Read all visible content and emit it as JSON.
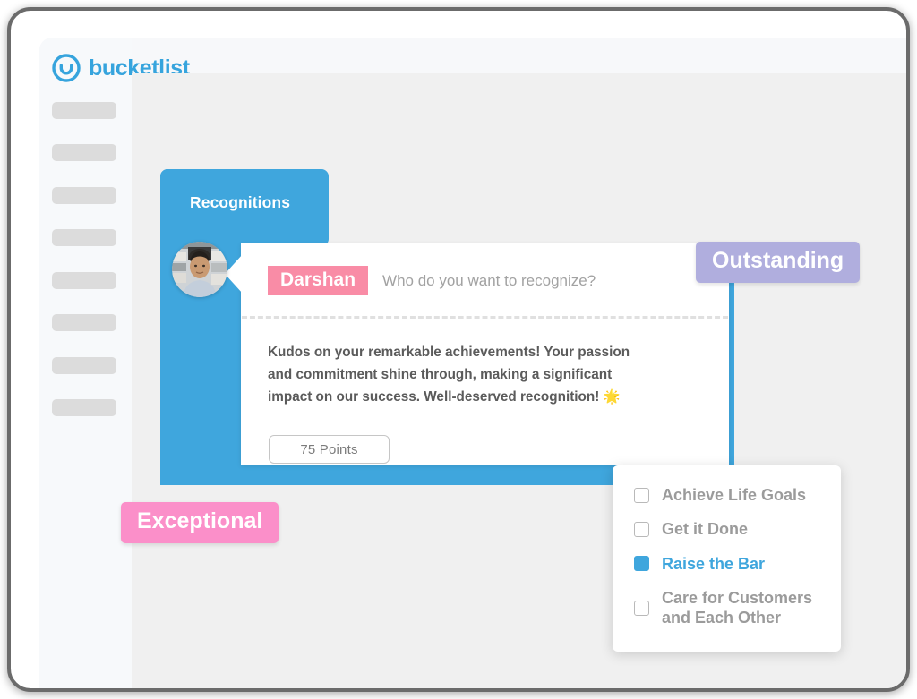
{
  "app": {
    "brand_name": "bucketlist",
    "logo_icon": "smile-circle-logo-icon",
    "accent_color": "#3fa6dd",
    "sidebar_placeholder_count": 8
  },
  "sidebar": {
    "nav_placeholders": [
      "",
      "",
      "",
      "",
      "",
      "",
      "",
      ""
    ]
  },
  "recognition_panel": {
    "title": "Recognitions",
    "avatar_alt": "darshan-avatar"
  },
  "card": {
    "recipient_name": "Darshan",
    "recipient_placeholder": "Who do you want to recognize?",
    "message": "Kudos on your remarkable achievements! Your passion and commitment shine through, making a significant impact on our success. Well-deserved recognition! 🌟",
    "points_label": "75 Points"
  },
  "badges": {
    "outstanding": {
      "label": "Outstanding",
      "color": "#b0aede"
    },
    "exceptional": {
      "label": "Exceptional",
      "color": "#fb8fc9"
    }
  },
  "values_dropdown": {
    "items": [
      {
        "label": "Achieve Life Goals",
        "checked": false
      },
      {
        "label": "Get it Done",
        "checked": false
      },
      {
        "label": "Raise the Bar",
        "checked": true
      },
      {
        "label": "Care for Customers and Each Other",
        "checked": false
      }
    ]
  }
}
